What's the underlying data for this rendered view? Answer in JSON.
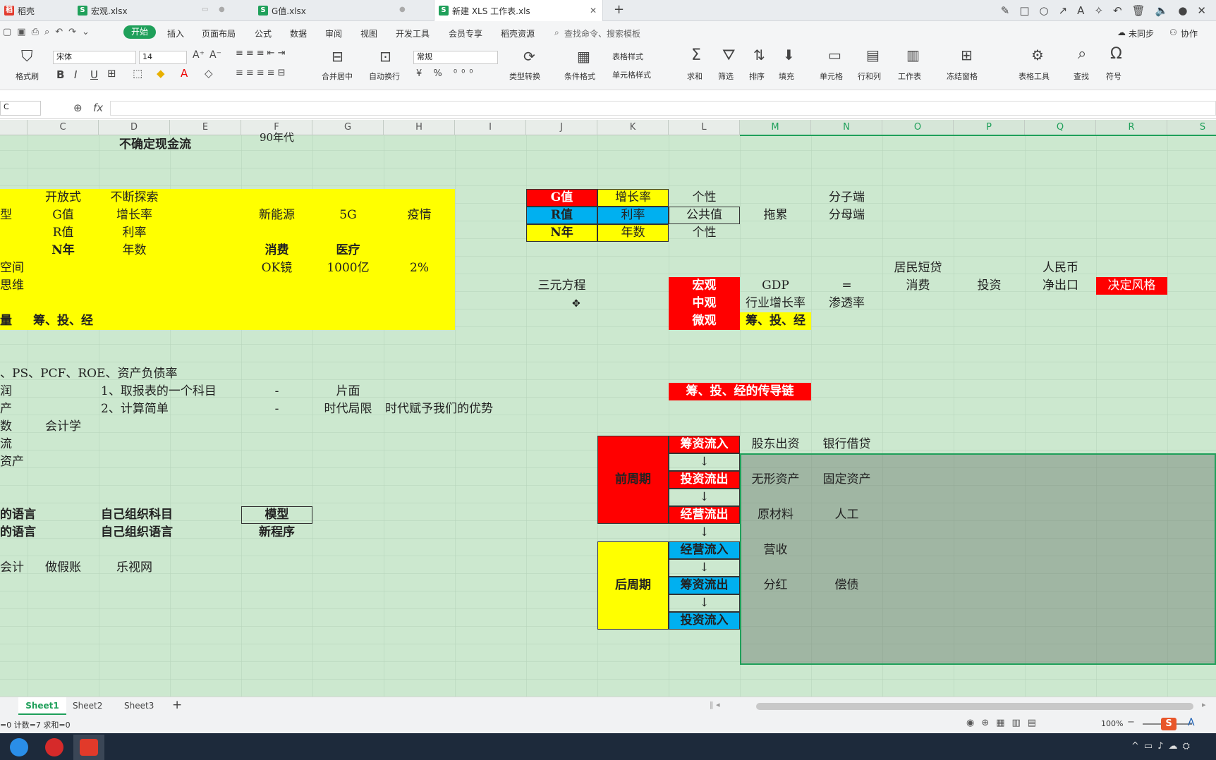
{
  "tabs": [
    {
      "label": "稻壳"
    },
    {
      "label": "宏观.xlsx"
    },
    {
      "label": "G值.xlsx"
    },
    {
      "label": "新建 XLS 工作表.xls"
    }
  ],
  "menu": {
    "start": "开始",
    "items": [
      "插入",
      "页面布局",
      "公式",
      "数据",
      "审阅",
      "视图",
      "开发工具",
      "会员专享",
      "稻壳资源"
    ],
    "search": "查找命令、搜索模板",
    "unsync": "未同步",
    "collab": "协作"
  },
  "ribbon": {
    "format_brush": "格式刷",
    "font_name": "宋体",
    "font_size": "14",
    "number_format": "常规",
    "merge": "合并居中",
    "wrap": "自动换行",
    "type_convert": "类型转换",
    "cond_format": "条件格式",
    "table_style": "表格样式",
    "cell_style": "单元格样式",
    "sum": "求和",
    "filter": "筛选",
    "sort": "排序",
    "fill": "填充",
    "cell": "单元格",
    "rowcol": "行和列",
    "sheet": "工作表",
    "freeze": "冻结窗格",
    "tools": "表格工具",
    "find": "查找",
    "symbol": "符号"
  },
  "formula": {
    "name_box": "C",
    "fx": "fx"
  },
  "columns": [
    "C",
    "D",
    "E",
    "F",
    "G",
    "H",
    "I",
    "J",
    "K",
    "L",
    "M",
    "N",
    "O",
    "P",
    "Q",
    "R",
    "S"
  ],
  "cells": {
    "c_title": "不确定现金流",
    "f_90": "90年代",
    "c_open": "开放式",
    "d_explore": "不断探索",
    "a_type": "型",
    "c_g": "G值",
    "d_growth": "增长率",
    "f_newenergy": "新能源",
    "g_5g": "5G",
    "h_epidemic": "疫情",
    "c_r": "R值",
    "d_rate": "利率",
    "c_n": "N年",
    "d_years": "年数",
    "f_consume": "消费",
    "g_medical": "医疗",
    "a_space": "空间",
    "f_ok": "OK镜",
    "g_1000": "1000亿",
    "h_2pct": "2%",
    "a_think": "思维",
    "a_amount": "量",
    "c_chain": "筹、投、经",
    "a_ps": "、PS、PCF、ROE、资产负债率",
    "a_profit": "润",
    "d_item1": "1、取报表的一个科目",
    "f_dash1": "-",
    "g_side": "片面",
    "a_asset": "产",
    "d_item2": "2、计算简单",
    "f_dash2": "-",
    "g_era": "时代局限",
    "h_adv": "时代赋予我们的优势",
    "a_shu": "数",
    "c_account": "会计学",
    "a_flow": "流",
    "a_assets2": "资产",
    "a_lang1": "的语言",
    "d_org1": "自己组织科目",
    "f_model": "模型",
    "a_lang2": "的语言",
    "d_org2": "自己组织语言",
    "f_newprog": "新程序",
    "a_acct": "会计",
    "c_fake": "做假账",
    "d_letv": "乐视网",
    "j_g": "G值",
    "k_growth": "增长率",
    "l_indiv1": "个性",
    "n_numer": "分子端",
    "j_r": "R值",
    "k_rate": "利率",
    "l_public": "公共值",
    "m_drag": "拖累",
    "n_denom": "分母端",
    "j_n": "N年",
    "k_years": "年数",
    "l_indiv2": "个性",
    "o_loan": "居民短贷",
    "q_rmb": "人民币",
    "j_eq3": "三元方程",
    "l_macro": "宏观",
    "m_gdp": "GDP",
    "n_eq": "=",
    "o_consume": "消费",
    "p_invest": "投资",
    "q_netexp": "净出口",
    "r_style": "决定风格",
    "l_meso": "中观",
    "m_indgrowth": "行业增长率",
    "n_penetration": "渗透率",
    "l_micro": "微观",
    "m_chain": "筹、投、经",
    "l_chainlink": "筹、投、经的传导链",
    "k_pre": "前周期",
    "l_fin_in": "筹资流入",
    "m_share": "股东出资",
    "n_bank": "银行借贷",
    "arrow": "↓",
    "l_inv_out": "投资流出",
    "m_intangible": "无形资产",
    "n_fixed": "固定资产",
    "l_op_out": "经营流出",
    "m_material": "原材料",
    "n_labor": "人工",
    "k_post": "后周期",
    "l_op_in": "经营流入",
    "m_revenue": "营收",
    "l_fin_out": "筹资流出",
    "m_dividend": "分红",
    "n_debt": "偿债",
    "l_inv_in": "投资流入"
  },
  "sheets": [
    {
      "label": "Sheet1"
    },
    {
      "label": "Sheet2"
    },
    {
      "label": "Sheet3"
    }
  ],
  "status": {
    "left": "=0  计数=7  求和=0",
    "zoom": "100%"
  },
  "colors": {
    "red": "#ff0000",
    "yellow": "#ffff00",
    "blue": "#00b0f0",
    "grid_bg": "#cce8cf",
    "select": "#1fa05a",
    "wps_green": "#1fa05a"
  }
}
